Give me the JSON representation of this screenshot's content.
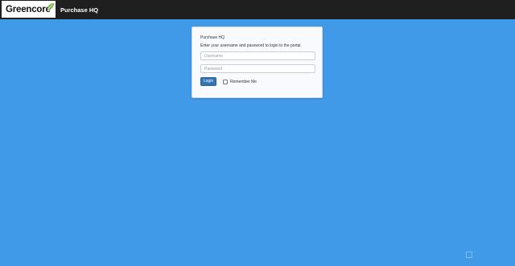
{
  "header": {
    "logo_text": "Greencore",
    "app_title": "Purchase HQ"
  },
  "login": {
    "title": "Purchase HQ",
    "subtitle": "Enter your username and password to login to the portal",
    "username_placeholder": "Username",
    "password_placeholder": "Password",
    "login_label": "Login",
    "remember_label": "Remember Me",
    "remember_checked": false
  },
  "watermark": {
    "text": ""
  },
  "colors": {
    "background": "#419ae8",
    "topbar": "#1f1f1f",
    "logo_leaf": "#7ab648",
    "login_button": "#3273b5"
  },
  "icons": {
    "logo": "leaf-icon",
    "watermark": "watermark-icon"
  }
}
